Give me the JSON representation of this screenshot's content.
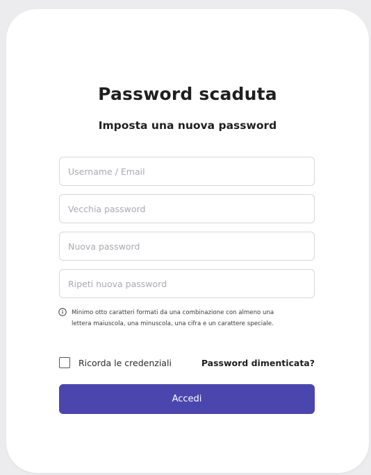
{
  "header": {
    "title": "Password scaduta",
    "subtitle": "Imposta una nuova password"
  },
  "form": {
    "username": {
      "placeholder": "Username / Email",
      "value": ""
    },
    "old_password": {
      "placeholder": "Vecchia password",
      "value": ""
    },
    "new_password": {
      "placeholder": "Nuova password",
      "value": ""
    },
    "repeat_password": {
      "placeholder": "Ripeti nuova password",
      "value": ""
    },
    "hint_line1": "Minimo otto caratteri formati da una combinazione con almeno una",
    "hint_line2": "lettera maiuscola, una minuscola, una cifra e un carattere speciale.",
    "remember_label": "Ricorda le credenziali",
    "remember_checked": false,
    "forgot_label": "Password dimenticata?",
    "submit_label": "Accedi"
  },
  "icons": {
    "hint": "info-icon"
  },
  "colors": {
    "primary": "#4a46ad",
    "background": "#ececee",
    "card": "#ffffff"
  }
}
